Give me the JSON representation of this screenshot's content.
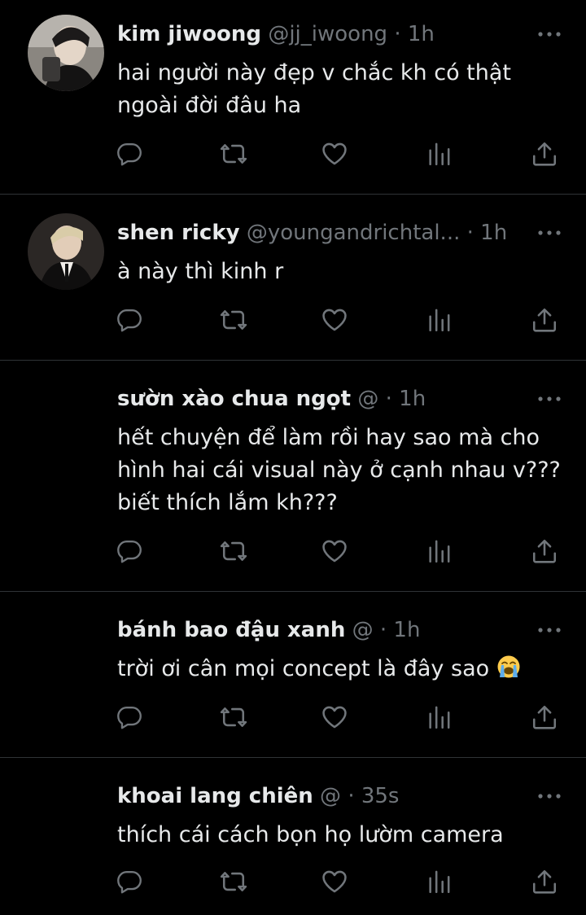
{
  "colors": {
    "background": "#000000",
    "text": "#e7e9ea",
    "muted": "#71767b",
    "divider": "#2f3336"
  },
  "tweets": [
    {
      "name": "kim jiwoong",
      "handle": "@jj_iwoong",
      "dot": "·",
      "time": "1h",
      "lines": [
        "hai người này đẹp v chắc kh có thật",
        "ngoài đời đâu ha"
      ],
      "has_avatar": true
    },
    {
      "name": "shen ricky",
      "handle": "@youngandrichtal...",
      "dot": "·",
      "time": "1h",
      "lines": [
        "à này thì kinh r"
      ],
      "has_avatar": true
    },
    {
      "name": "sườn xào chua ngọt",
      "handle": "@",
      "dot": "·",
      "time": "1h",
      "lines": [
        "hết chuyện để làm rồi hay sao mà cho",
        "hình hai cái visual này ở cạnh nhau v???",
        "biết thích lắm kh???"
      ],
      "has_avatar": false
    },
    {
      "name": "bánh bao đậu xanh",
      "handle": "@",
      "dot": "·",
      "time": "1h",
      "lines": [
        "trời ơi cân mọi concept là đây sao"
      ],
      "emoji": "loudly-crying-face-icon",
      "has_avatar": false
    },
    {
      "name": "khoai lang chiên",
      "handle": "@",
      "dot": "·",
      "time": "35s",
      "lines": [
        "thích cái cách bọn họ lườm camera"
      ],
      "has_avatar": false
    }
  ],
  "icons": [
    "reply-icon",
    "retweet-icon",
    "like-icon",
    "analytics-icon",
    "share-icon",
    "more-icon"
  ]
}
